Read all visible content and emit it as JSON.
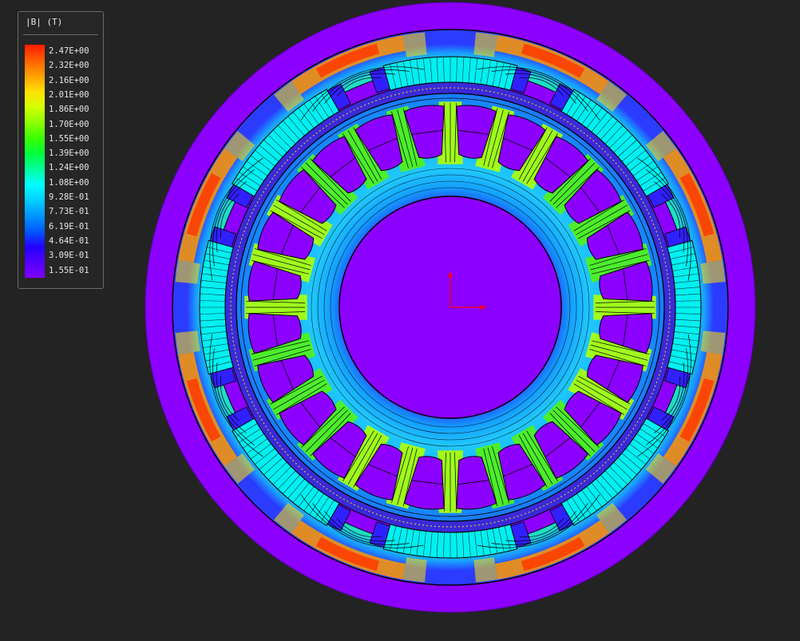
{
  "legend": {
    "title": "|B| (T)",
    "labels": [
      "2.47E+00",
      "2.32E+00",
      "2.16E+00",
      "2.01E+00",
      "1.86E+00",
      "1.70E+00",
      "1.55E+00",
      "1.39E+00",
      "1.24E+00",
      "1.08E+00",
      "9.28E-01",
      "7.73E-01",
      "6.19E-01",
      "4.64E-01",
      "3.09E-01",
      "1.55E-01"
    ],
    "colors": [
      "#ff1a00",
      "#ff6000",
      "#ff9f00",
      "#ffdf00",
      "#d5ff00",
      "#8cff00",
      "#3cff00",
      "#00ff3c",
      "#00ff9a",
      "#00ffff",
      "#00cfff",
      "#0096ff",
      "#005aff",
      "#2400ff",
      "#5300ff",
      "#8000ff"
    ]
  },
  "colors": {
    "background": "#232323",
    "air": "#8c00ff",
    "shaft": "#8c00ff",
    "magnet": "#00f0f0",
    "outline": "#000000",
    "axis_x": "#ff0000",
    "axis_y": "#ff0000"
  },
  "model": {
    "stator_slots": 24,
    "rotor_magnet_poles": 8
  }
}
